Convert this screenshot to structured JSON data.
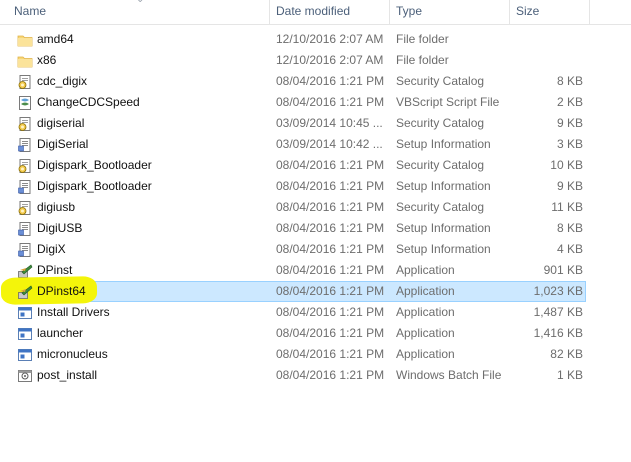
{
  "columns": {
    "name": "Name",
    "date": "Date modified",
    "type": "Type",
    "size": "Size"
  },
  "files": [
    {
      "name": "amd64",
      "date": "12/10/2016 2:07 AM",
      "type": "File folder",
      "size": "",
      "icon": "folder-icon"
    },
    {
      "name": "x86",
      "date": "12/10/2016 2:07 AM",
      "type": "File folder",
      "size": "",
      "icon": "folder-icon"
    },
    {
      "name": "cdc_digix",
      "date": "08/04/2016 1:21 PM",
      "type": "Security Catalog",
      "size": "8 KB",
      "icon": "security-catalog-icon"
    },
    {
      "name": "ChangeCDCSpeed",
      "date": "08/04/2016 1:21 PM",
      "type": "VBScript Script File",
      "size": "2 KB",
      "icon": "vbscript-icon"
    },
    {
      "name": "digiserial",
      "date": "03/09/2014 10:45 ...",
      "type": "Security Catalog",
      "size": "9 KB",
      "icon": "security-catalog-icon"
    },
    {
      "name": "DigiSerial",
      "date": "03/09/2014 10:42 ...",
      "type": "Setup Information",
      "size": "3 KB",
      "icon": "setup-info-icon"
    },
    {
      "name": "Digispark_Bootloader",
      "date": "08/04/2016 1:21 PM",
      "type": "Security Catalog",
      "size": "10 KB",
      "icon": "security-catalog-icon"
    },
    {
      "name": "Digispark_Bootloader",
      "date": "08/04/2016 1:21 PM",
      "type": "Setup Information",
      "size": "9 KB",
      "icon": "setup-info-icon"
    },
    {
      "name": "digiusb",
      "date": "08/04/2016 1:21 PM",
      "type": "Security Catalog",
      "size": "11 KB",
      "icon": "security-catalog-icon"
    },
    {
      "name": "DigiUSB",
      "date": "08/04/2016 1:21 PM",
      "type": "Setup Information",
      "size": "8 KB",
      "icon": "setup-info-icon"
    },
    {
      "name": "DigiX",
      "date": "08/04/2016 1:21 PM",
      "type": "Setup Information",
      "size": "4 KB",
      "icon": "setup-info-icon"
    },
    {
      "name": "DPinst",
      "date": "08/04/2016 1:21 PM",
      "type": "Application",
      "size": "901 KB",
      "icon": "installer-app-icon"
    },
    {
      "name": "DPinst64",
      "date": "08/04/2016 1:21 PM",
      "type": "Application",
      "size": "1,023 KB",
      "icon": "installer-app-icon",
      "selected": true
    },
    {
      "name": "Install Drivers",
      "date": "08/04/2016 1:21 PM",
      "type": "Application",
      "size": "1,487 KB",
      "icon": "application-window-icon"
    },
    {
      "name": "launcher",
      "date": "08/04/2016 1:21 PM",
      "type": "Application",
      "size": "1,416 KB",
      "icon": "application-window-icon"
    },
    {
      "name": "micronucleus",
      "date": "08/04/2016 1:21 PM",
      "type": "Application",
      "size": "82 KB",
      "icon": "application-window-icon"
    },
    {
      "name": "post_install",
      "date": "08/04/2016 1:21 PM",
      "type": "Windows Batch File",
      "size": "1 KB",
      "icon": "batch-file-icon"
    }
  ],
  "colors": {
    "selection_bg": "#cce8ff",
    "selection_border": "#99d1ff",
    "highlight_marker": "#f4f50a",
    "folder": "#f8d775"
  }
}
